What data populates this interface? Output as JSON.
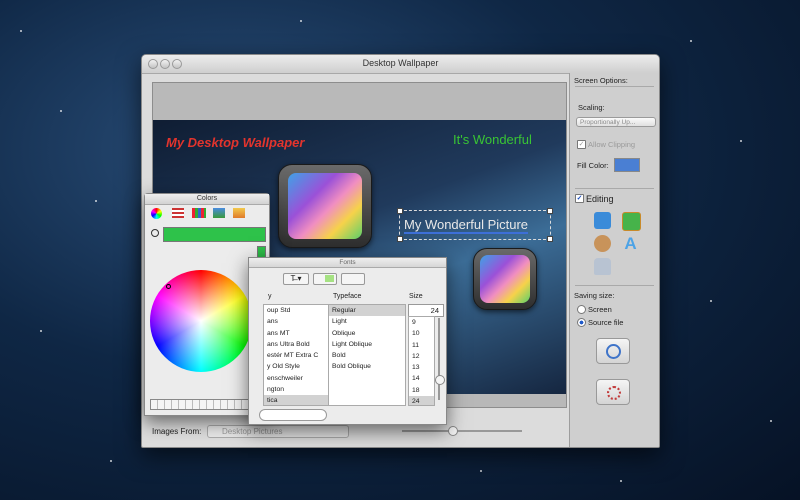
{
  "window": {
    "title": "Desktop Wallpaper"
  },
  "canvas": {
    "headline": "My Desktop Wallpaper",
    "subhead": "It's Wonderful",
    "picture_text": "My Wonderful Picture"
  },
  "bottom": {
    "images_from_label": "Images From:",
    "images_from_value": "Desktop Pictures"
  },
  "side": {
    "screen_options": "Screen Options:",
    "scaling_label": "Scaling:",
    "scaling_value": "Proportionally Up...",
    "allow_clipping": "Allow Clipping",
    "fill_color_label": "Fill Color:",
    "fill_color": "#4a7fd3",
    "editing_label": "Editing",
    "saving_size": "Saving size:",
    "screen_option": "Screen",
    "source_file_option": "Source file",
    "selected_size": "Source file"
  },
  "colors_panel": {
    "title": "Colors",
    "current_color": "#2ec24a"
  },
  "fonts_panel": {
    "title": "Fonts",
    "family_header": "y",
    "typeface_header": "Typeface",
    "size_header": "Size",
    "size_value": "24",
    "families": [
      "oup Std",
      "ans",
      "ans MT",
      "ans Ultra Bold",
      "estér MT Extra C",
      "y Old Style",
      "enschweiler",
      "ngton",
      "tica"
    ],
    "typefaces": [
      "Regular",
      "Light",
      "Oblique",
      "Light Oblique",
      "Bold",
      "Bold Oblique"
    ],
    "sizes": [
      "9",
      "10",
      "11",
      "12",
      "13",
      "14",
      "18",
      "24"
    ]
  }
}
